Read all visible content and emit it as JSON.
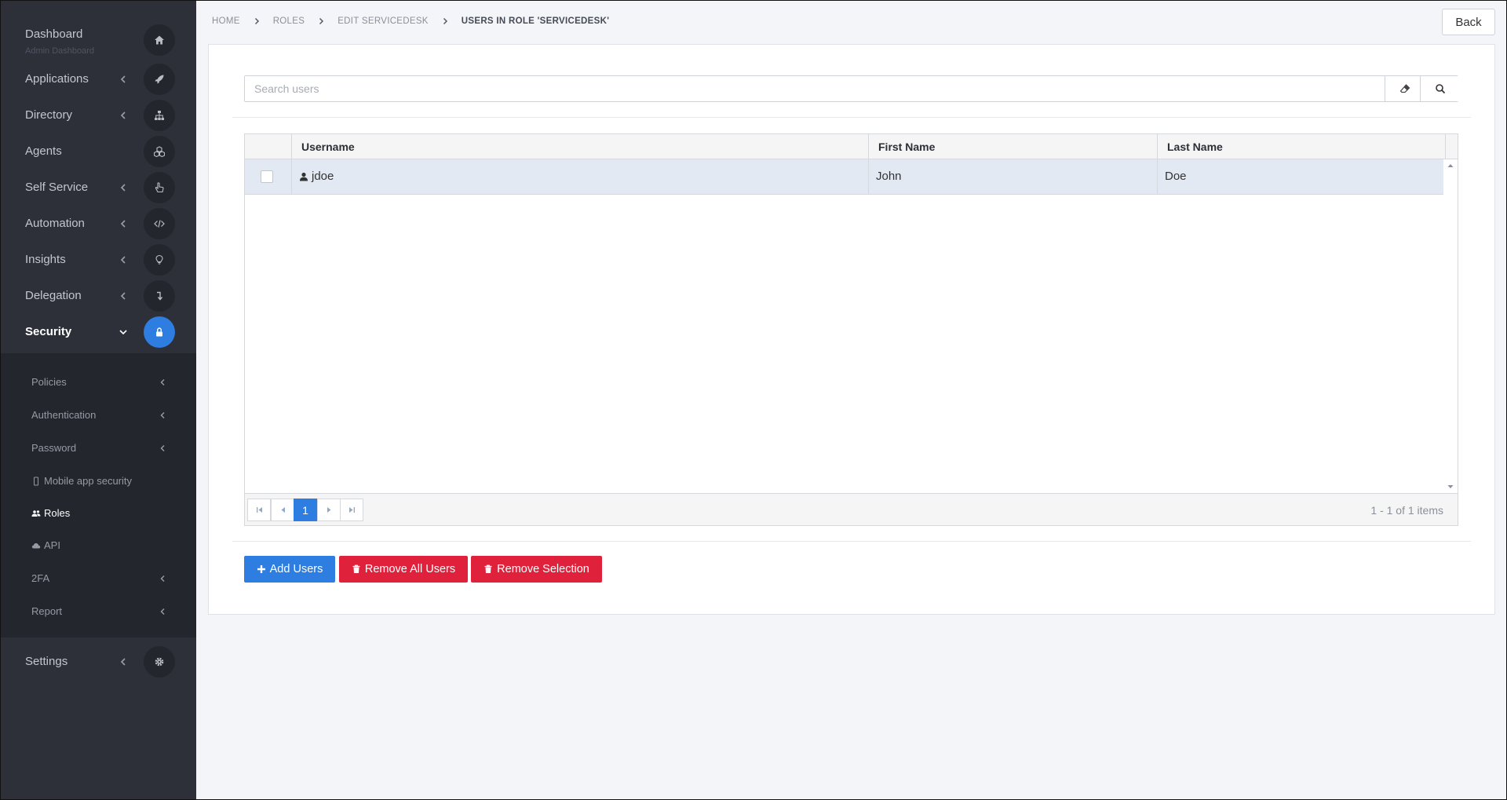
{
  "sidebar": {
    "items": [
      {
        "label": "Dashboard",
        "sub": "Admin Dashboard",
        "icon": "home-icon"
      },
      {
        "label": "Applications",
        "icon": "rocket-icon"
      },
      {
        "label": "Directory",
        "icon": "sitemap-icon"
      },
      {
        "label": "Agents",
        "icon": "cubes-icon"
      },
      {
        "label": "Self Service",
        "icon": "hand-pointer-icon"
      },
      {
        "label": "Automation",
        "icon": "code-icon"
      },
      {
        "label": "Insights",
        "icon": "lightbulb-icon"
      },
      {
        "label": "Delegation",
        "icon": "level-down-icon"
      },
      {
        "label": "Security",
        "icon": "lock-icon"
      },
      {
        "label": "Settings",
        "icon": "gear-icon"
      }
    ],
    "security_submenu": [
      {
        "label": "Policies"
      },
      {
        "label": "Authentication"
      },
      {
        "label": "Password"
      },
      {
        "label": "Mobile app security",
        "icon": "mobile-icon"
      },
      {
        "label": "Roles",
        "icon": "users-icon"
      },
      {
        "label": "API",
        "icon": "cloud-icon"
      },
      {
        "label": "2FA"
      },
      {
        "label": "Report"
      }
    ]
  },
  "breadcrumb": [
    "Home",
    "Roles",
    "Edit ServiceDesk",
    "Users in Role 'ServiceDesk'"
  ],
  "back_label": "Back",
  "search": {
    "placeholder": "Search users",
    "value": ""
  },
  "grid": {
    "columns": [
      "Username",
      "First Name",
      "Last Name"
    ],
    "rows": [
      {
        "username": "jdoe",
        "first_name": "John",
        "last_name": "Doe"
      }
    ],
    "current_page": "1",
    "info": "1 - 1 of 1 items"
  },
  "actions": {
    "add_users": "Add Users",
    "remove_all": "Remove All Users",
    "remove_selection": "Remove Selection"
  },
  "colors": {
    "sidebar_bg": "#2d3039",
    "submenu_bg": "#23262d",
    "accent": "#2e7de0",
    "danger": "#e0213b",
    "selected_row": "#e3e9f2"
  }
}
